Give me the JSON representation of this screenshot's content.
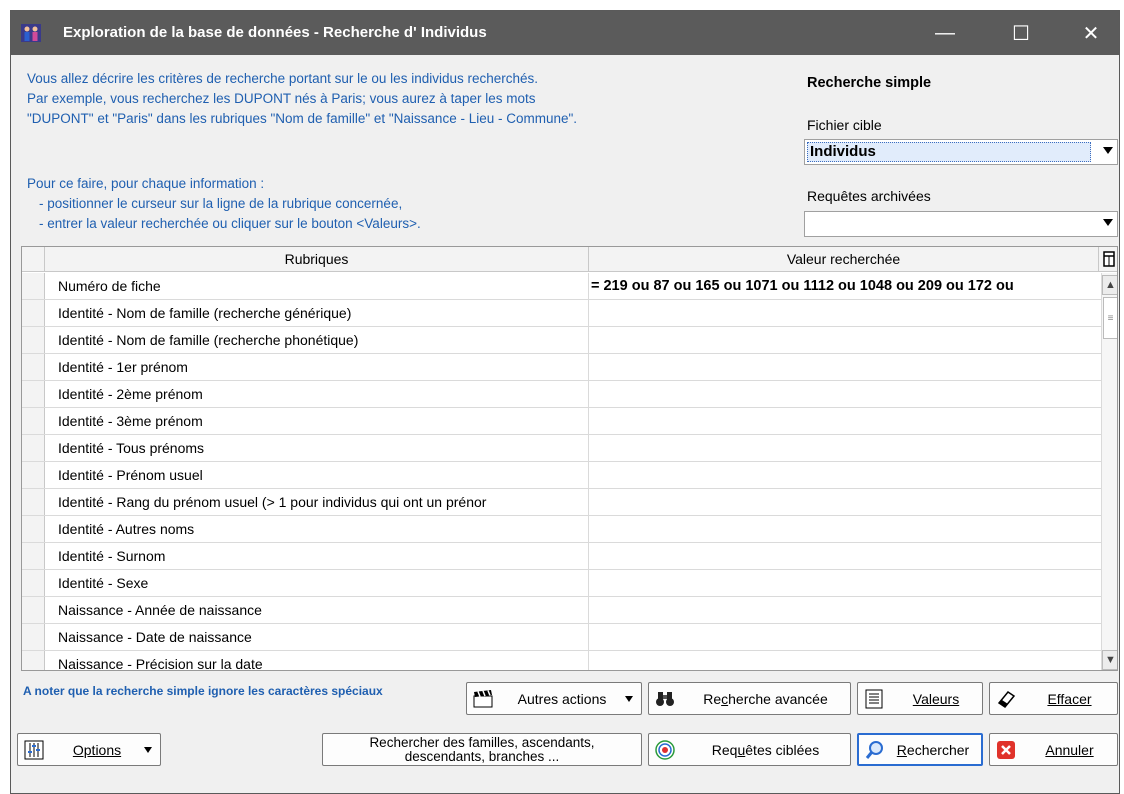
{
  "window": {
    "title": "Exploration de la base de données - Recherche d' Individus",
    "min_glyph": "—",
    "max_glyph": "☐",
    "close_glyph": "✕"
  },
  "intro": {
    "line1": "Vous allez décrire les critères de recherche portant sur le ou les individus recherchés.",
    "line2": "Par exemple, vous recherchez les DUPONT nés à  Paris; vous aurez à taper les mots",
    "line3": "\"DUPONT\" et \"Paris\" dans les rubriques \"Nom de famille\" et \"Naissance - Lieu - Commune\".",
    "line4": "Pour ce faire, pour chaque information :",
    "line5": "- positionner le curseur sur la ligne de la rubrique concernée,",
    "line6": "- entrer la valeur recherchée ou cliquer sur le bouton <Valeurs>."
  },
  "side": {
    "title": "Recherche simple",
    "fichier_label": "Fichier cible",
    "fichier_value": "Individus",
    "requetes_label": "Requêtes archivées",
    "requetes_value": ""
  },
  "grid": {
    "col_rubriques": "Rubriques",
    "col_valeur": "Valeur recherchée",
    "rows": [
      {
        "rubrique": "Numéro de fiche",
        "valeur": "= 219 ou 87 ou 165 ou 1071 ou 1112 ou 1048 ou 209 ou 172 ou"
      },
      {
        "rubrique": "Identité - Nom de famille (recherche générique)",
        "valeur": ""
      },
      {
        "rubrique": "Identité - Nom de famille (recherche phonétique)",
        "valeur": ""
      },
      {
        "rubrique": "Identité - 1er prénom",
        "valeur": ""
      },
      {
        "rubrique": "Identité - 2ème prénom",
        "valeur": ""
      },
      {
        "rubrique": "Identité - 3ème prénom",
        "valeur": ""
      },
      {
        "rubrique": "Identité - Tous prénoms",
        "valeur": ""
      },
      {
        "rubrique": "Identité - Prénom usuel",
        "valeur": ""
      },
      {
        "rubrique": "Identité - Rang du prénom usuel (> 1 pour individus qui ont un prénor",
        "valeur": ""
      },
      {
        "rubrique": "Identité - Autres noms",
        "valeur": ""
      },
      {
        "rubrique": "Identité - Surnom",
        "valeur": ""
      },
      {
        "rubrique": "Identité - Sexe",
        "valeur": ""
      },
      {
        "rubrique": "Naissance - Année de naissance",
        "valeur": ""
      },
      {
        "rubrique": "Naissance - Date de naissance",
        "valeur": ""
      },
      {
        "rubrique": "Naissance - Précision sur la date",
        "valeur": ""
      }
    ]
  },
  "note": "A noter que la recherche simple ignore les caractères spéciaux",
  "buttons": {
    "autres_actions": "Autres actions",
    "recherche_avancee_pre": "Re",
    "recherche_avancee_u": "c",
    "recherche_avancee_post": "herche avancée",
    "valeurs": "Valeurs",
    "effacer": "Effacer",
    "options": "Options",
    "familles_line1": "Rechercher des familles, ascendants,",
    "familles_line2": "descendants, branches ...",
    "requetes_pre": "Req",
    "requetes_u": "u",
    "requetes_post": "êtes ciblées",
    "rechercher_u": "R",
    "rechercher_post": "echercher",
    "annuler": "Annuler"
  },
  "colors": {
    "titlebar": "#5b5b5b",
    "intro_text": "#1f5fb0",
    "selection": "#e1ecfb",
    "default_button_border": "#2a6cd1"
  }
}
